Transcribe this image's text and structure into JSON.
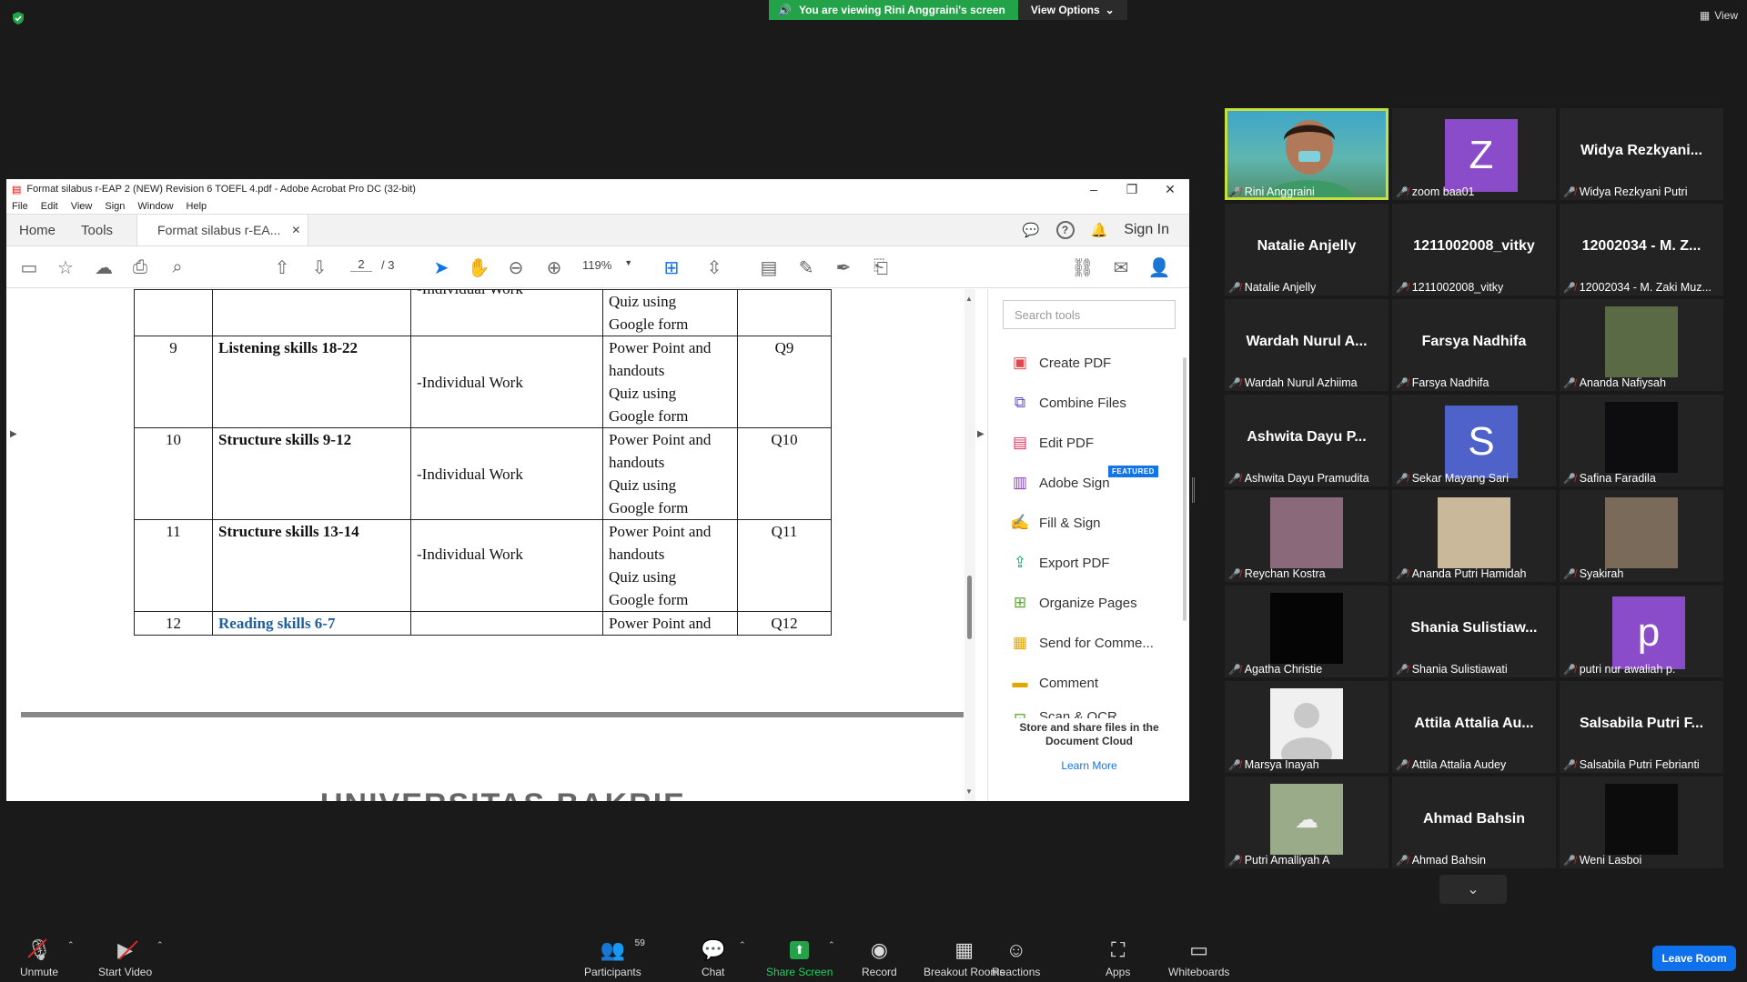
{
  "banner": {
    "text": "You are viewing Rini Anggraini's screen",
    "options": "View Options"
  },
  "top_right": {
    "view": "View"
  },
  "acrobat": {
    "title": "Format silabus r-EAP 2 (NEW) Revision 6 TOEFL 4.pdf - Adobe Acrobat Pro DC (32-bit)",
    "menu": [
      "File",
      "Edit",
      "View",
      "Sign",
      "Window",
      "Help"
    ],
    "tabs": {
      "home": "Home",
      "tools": "Tools",
      "doc": "Format silabus r-EA...",
      "sign_in": "Sign In"
    },
    "page_current": "2",
    "page_total": "/ 3",
    "zoom": "119%",
    "table_rows": [
      {
        "num": "",
        "topic": "",
        "work": "-Individual Work",
        "media": [
          "Quiz using",
          "Google form"
        ],
        "assess": ""
      },
      {
        "num": "9",
        "topic": "Listening skills 18-22",
        "work": "-Individual Work",
        "media": [
          "Power Point and",
          "handouts",
          "Quiz using",
          "Google form"
        ],
        "assess": "Q9"
      },
      {
        "num": "10",
        "topic": "Structure skills 9-12",
        "work": "-Individual Work",
        "media": [
          "Power Point and",
          "handouts",
          "Quiz using",
          "Google form"
        ],
        "assess": "Q10"
      },
      {
        "num": "11",
        "topic": "Structure skills 13-14",
        "work": "-Individual Work",
        "media": [
          "Power Point and",
          "handouts",
          "Quiz using",
          "Google form"
        ],
        "assess": "Q11"
      },
      {
        "num": "12",
        "topic": "Reading skills 6-7",
        "work": "",
        "media": [
          "Power Point and"
        ],
        "assess": "Q12"
      }
    ],
    "footer_logo_text": "UNIVERSITAS  BAKRIE",
    "tools": {
      "search_placeholder": "Search tools",
      "items": [
        "Create PDF",
        "Combine Files",
        "Edit PDF",
        "Adobe Sign",
        "Fill & Sign",
        "Export PDF",
        "Organize Pages",
        "Send for Comme...",
        "Comment",
        "Scan & OCR"
      ],
      "featured": "FEATURED",
      "cloud_text": "Store and share files in the Document Cloud",
      "learn_more": "Learn More"
    }
  },
  "participants": [
    {
      "display": "",
      "label": "Rini Anggraini",
      "type": "video"
    },
    {
      "display": "Z",
      "label": "zoom baa01",
      "type": "letter",
      "color": "#8a4cc8"
    },
    {
      "display": "Widya  Rezkyani...",
      "label": "Widya Rezkyani Putri",
      "type": "name"
    },
    {
      "display": "Natalie Anjelly",
      "label": "Natalie Anjelly",
      "type": "name"
    },
    {
      "display": "1211002008_vitky",
      "label": "1211002008_vitky",
      "type": "name"
    },
    {
      "display": "12002034 - M. Z...",
      "label": "12002034 - M. Zaki Muz...",
      "type": "name"
    },
    {
      "display": "Wardah Nurul A...",
      "label": "Wardah Nurul Azhiima",
      "type": "name"
    },
    {
      "display": "Farsya Nadhifa",
      "label": "Farsya Nadhifa",
      "type": "name"
    },
    {
      "display": "",
      "label": "Ananda Nafiysah",
      "type": "photo",
      "color": "#5a6a45"
    },
    {
      "display": "Ashwita Dayu P...",
      "label": "Ashwita Dayu Pramudita",
      "type": "name"
    },
    {
      "display": "S",
      "label": "Sekar Mayang Sari",
      "type": "letter",
      "color": "#4f62c9"
    },
    {
      "display": "",
      "label": "Safina Faradila",
      "type": "photo",
      "color": "#0d0d10"
    },
    {
      "display": "",
      "label": "Reychan Kostra",
      "type": "photo",
      "color": "#8a6a7a"
    },
    {
      "display": "",
      "label": "Ananda Putri Hamidah",
      "type": "photo",
      "color": "#c9b89a"
    },
    {
      "display": "",
      "label": "Syakirah",
      "type": "photo",
      "color": "#7a6a5a"
    },
    {
      "display": "",
      "label": "Agatha Christie",
      "type": "photo",
      "color": "#050505"
    },
    {
      "display": "Shania  Sulistiaw...",
      "label": "Shania Sulistiawati",
      "type": "name"
    },
    {
      "display": "p",
      "label": "putri nur awaliah p.",
      "type": "letter",
      "color": "#8a4cc8"
    },
    {
      "display": "",
      "label": "Marsya Inayah",
      "type": "photo",
      "color": "#f0f0f0"
    },
    {
      "display": "Attila Attalia Au...",
      "label": "Attila Attalia Audey",
      "type": "name"
    },
    {
      "display": "Salsabila Putri F...",
      "label": "Salsabila Putri Febrianti",
      "type": "name"
    },
    {
      "display": "",
      "label": "Putri Amalliyah A",
      "type": "photo",
      "color": "#9aab8a"
    },
    {
      "display": "Ahmad Bahsin",
      "label": "Ahmad Bahsin",
      "type": "name"
    },
    {
      "display": "",
      "label": "Weni Lasboi",
      "type": "photo",
      "color": "#0c0c0c"
    }
  ],
  "bottombar": {
    "unmute": "Unmute",
    "start_video": "Start Video",
    "participants": "Participants",
    "participant_count": "59",
    "chat": "Chat",
    "share_screen": "Share Screen",
    "record": "Record",
    "breakout": "Breakout Rooms",
    "reactions": "Reactions",
    "apps": "Apps",
    "whiteboards": "Whiteboards",
    "leave": "Leave Room"
  }
}
